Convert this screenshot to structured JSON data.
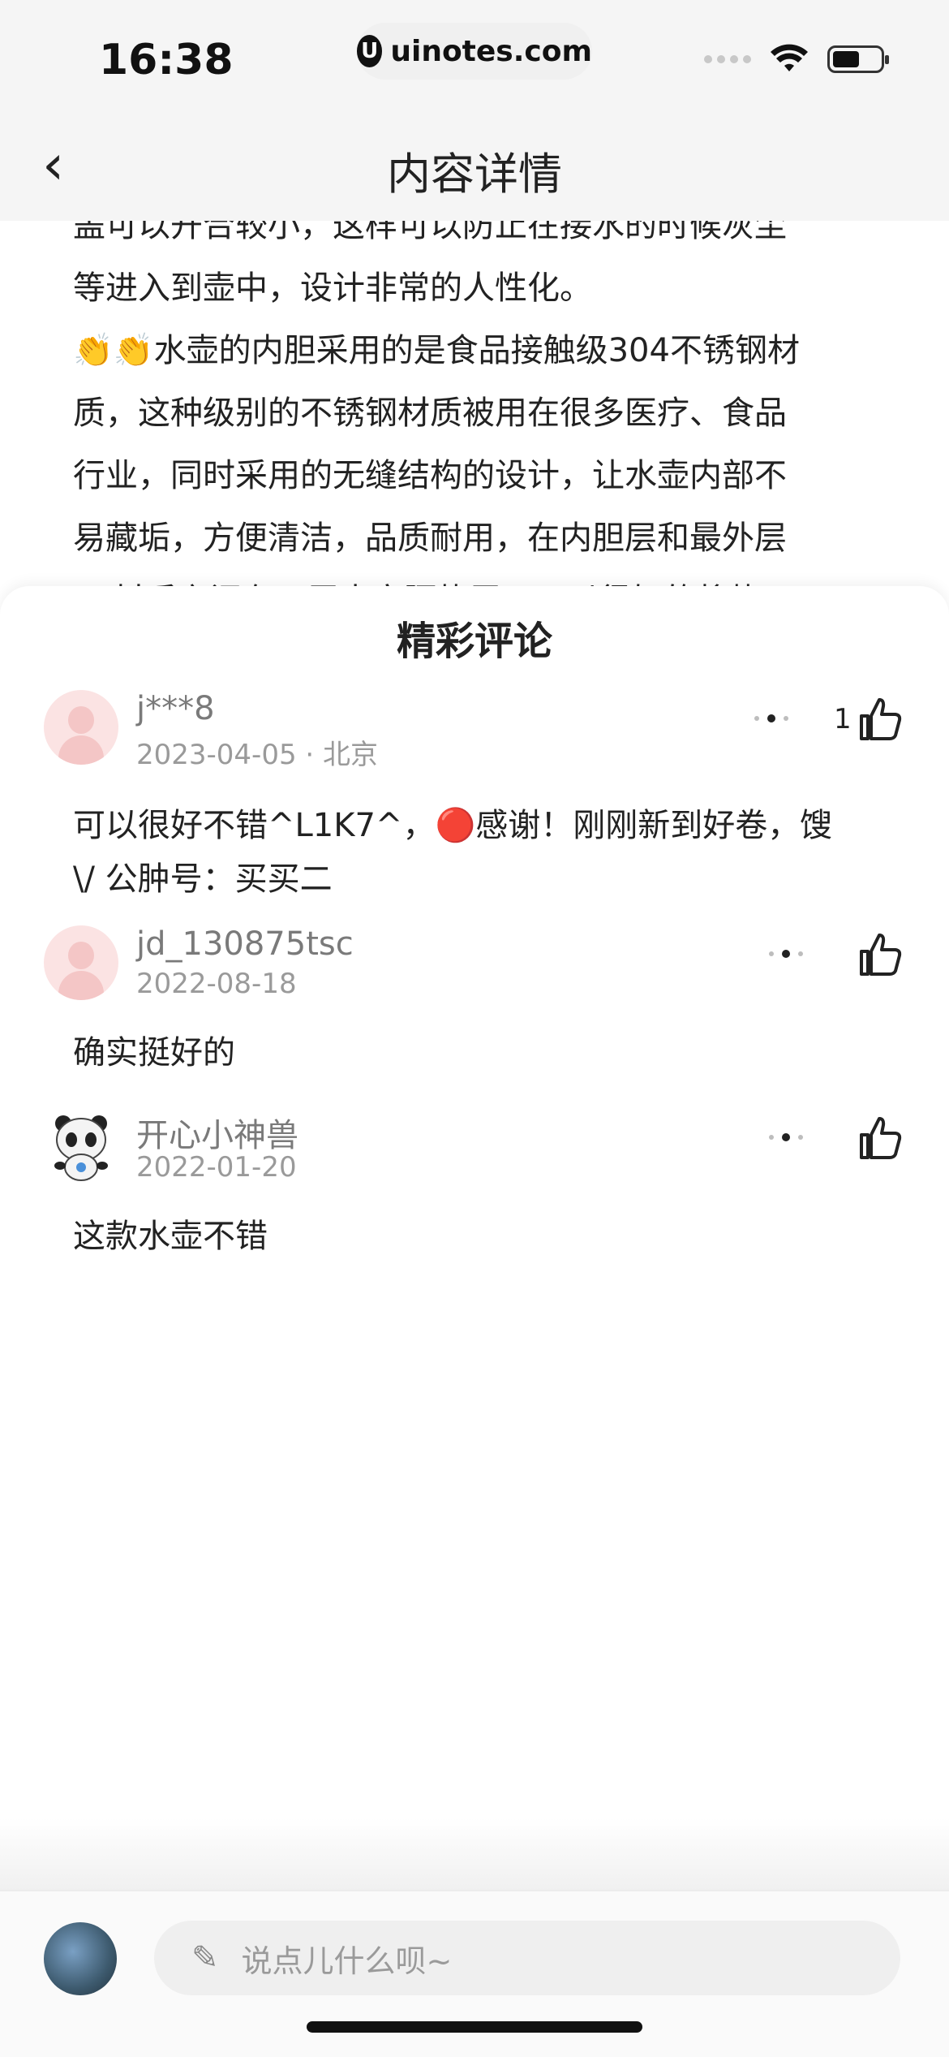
{
  "status_bar": {
    "time": "16:38",
    "url": "uinotes.com",
    "url_logo": "U"
  },
  "header": {
    "back_icon": "‹",
    "title": "内容详情"
  },
  "article": {
    "lines": [
      "盖可以开合较小，这样可以防止在接水的时候灰尘",
      "等进入到壶中，设计非常的人性化。",
      "👏👏水壶的内胆采用的是食品接触级304不锈钢材",
      "质，这种级别的不锈钢材质被用在很多医疗、食品",
      "行业，同时采用的无缝结构的设计，让水壶内部不",
      "易藏垢，方便清洁，品质耐用，在内胆层和最外层",
      "PP材质之间有一层中空隔热层，可以很好的将热"
    ]
  },
  "comments_sheet": {
    "title": "精彩评论",
    "comments": [
      {
        "username": "j***8",
        "date": "2023-04-05",
        "location": " · 北京",
        "likes": "1",
        "text_lines": [
          "可以很好不错^L1K7^，🔴感谢！刚刚新到好卷，馊",
          "\\/ 公肿号：买买二"
        ]
      },
      {
        "username": "jd_130875tsc",
        "date": "2022-08-18",
        "location": "",
        "likes": "",
        "text_lines": [
          "确实挺好的"
        ]
      },
      {
        "username": "开心小神兽",
        "date": "2022-01-20",
        "location": "",
        "likes": "",
        "text_lines": [
          "这款水壶不错"
        ]
      }
    ]
  },
  "bottom_bar": {
    "placeholder": "说点儿什么呗~",
    "pencil_icon": "✎"
  },
  "icons": {
    "like": "thumbs-up-icon",
    "more": "more-dots-icon"
  }
}
